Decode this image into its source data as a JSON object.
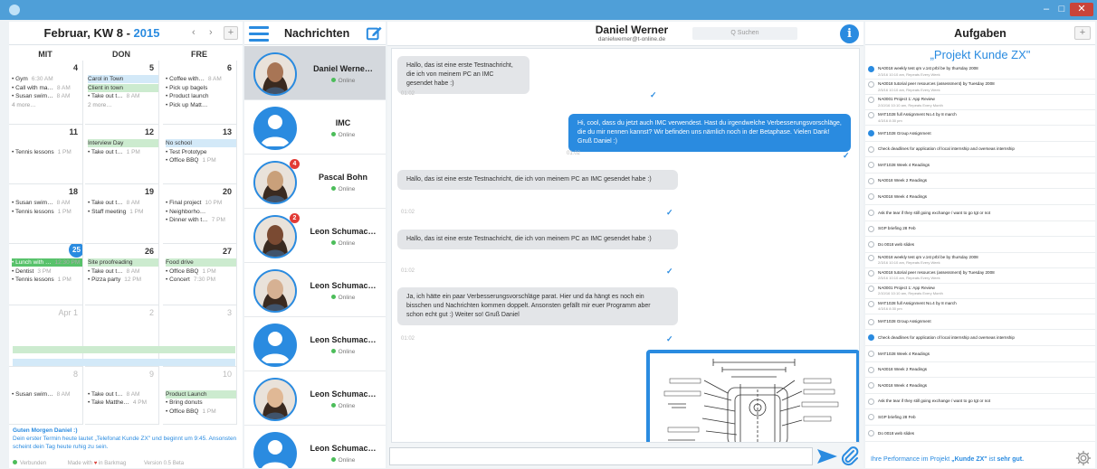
{
  "window": {
    "min": "‒",
    "max": "□",
    "close": "✕"
  },
  "calendar": {
    "month": "Februar, KW 8 - ",
    "year": "2015",
    "prev": "‹",
    "next": "›",
    "add": "+",
    "days": [
      "MIT",
      "DON",
      "FRE"
    ],
    "weeks": [
      {
        "days": [
          {
            "num": "4",
            "events": [
              {
                "txt": "• Gym",
                "time": "6:30 AM",
                "c": ""
              },
              {
                "txt": "• Call with ma…",
                "time": "8 AM",
                "c": ""
              },
              {
                "txt": "• Susan swim…",
                "time": "8 AM",
                "c": ""
              },
              {
                "txt": "4 more…",
                "time": "",
                "c": "m"
              }
            ]
          },
          {
            "num": "5",
            "events": [
              {
                "txt": "Carol in Town",
                "time": "",
                "c": "b"
              },
              {
                "txt": "Client in town",
                "time": "",
                "c": "g"
              },
              {
                "txt": "• Take out t…",
                "time": "8 AM",
                "c": ""
              },
              {
                "txt": "2 more…",
                "time": "",
                "c": "m"
              }
            ]
          },
          {
            "num": "6",
            "events": [
              {
                "txt": "• Coffee with…",
                "time": "8 AM",
                "c": ""
              },
              {
                "txt": "• Pick up bagels",
                "time": "",
                "c": ""
              },
              {
                "txt": "• Product launch",
                "time": "",
                "c": ""
              },
              {
                "txt": "• Pick up Matt…",
                "time": "",
                "c": ""
              }
            ]
          }
        ]
      },
      {
        "days": [
          {
            "num": "11",
            "events": [
              {
                "txt": "",
                "time": "",
                "c": ""
              },
              {
                "txt": "• Tennis lessons",
                "time": "1 PM",
                "c": ""
              }
            ]
          },
          {
            "num": "12",
            "events": [
              {
                "txt": "Interview Day",
                "time": "",
                "c": "g"
              },
              {
                "txt": "• Take out t…",
                "time": "1 PM",
                "c": ""
              }
            ]
          },
          {
            "num": "13",
            "events": [
              {
                "txt": "No school",
                "time": "",
                "c": "b"
              },
              {
                "txt": "• Test Prototype",
                "time": "",
                "c": ""
              },
              {
                "txt": "• Office BBQ",
                "time": "1 PM",
                "c": ""
              }
            ]
          }
        ]
      },
      {
        "days": [
          {
            "num": "18",
            "events": [
              {
                "txt": "• Susan swim…",
                "time": "8 AM",
                "c": ""
              },
              {
                "txt": "• Tennis lessons",
                "time": "1 PM",
                "c": ""
              }
            ]
          },
          {
            "num": "19",
            "events": [
              {
                "txt": "• Take out t…",
                "time": "8 AM",
                "c": ""
              },
              {
                "txt": "• Staff meeting",
                "time": "1 PM",
                "c": ""
              }
            ]
          },
          {
            "num": "20",
            "events": [
              {
                "txt": "• Final project",
                "time": "10 PM",
                "c": ""
              },
              {
                "txt": "• Neighborho…",
                "time": "",
                "c": ""
              },
              {
                "txt": "• Dinner with t…",
                "time": "7 PM",
                "c": ""
              }
            ]
          }
        ]
      },
      {
        "days": [
          {
            "num": "25",
            "events": [
              {
                "txt": "• Lunch with …",
                "time": "12:30 PM",
                "c": "gb"
              },
              {
                "txt": "• Dentist",
                "time": "3 PM",
                "c": ""
              },
              {
                "txt": "• Tennis lessons",
                "time": "1 PM",
                "c": ""
              }
            ]
          },
          {
            "num": "26",
            "events": [
              {
                "txt": "Site proofreading",
                "time": "",
                "c": "g"
              },
              {
                "txt": "• Take out t…",
                "time": "8 AM",
                "c": ""
              },
              {
                "txt": "• Pizza party",
                "time": "12 PM",
                "c": ""
              }
            ]
          },
          {
            "num": "27",
            "events": [
              {
                "txt": "Food drive",
                "time": "",
                "c": "g"
              },
              {
                "txt": "• Office BBQ",
                "time": "1 PM",
                "c": ""
              },
              {
                "txt": "• Concert",
                "time": "7:30 PM",
                "c": ""
              }
            ]
          }
        ]
      },
      {
        "days": [
          {
            "num": "Apr 1",
            "events": []
          },
          {
            "num": "2",
            "events": []
          },
          {
            "num": "3",
            "events": []
          }
        ]
      },
      {
        "days": [
          {
            "num": "8",
            "events": [
              {
                "txt": "",
                "time": "",
                "c": ""
              },
              {
                "txt": "• Susan swim…",
                "time": "8 AM",
                "c": ""
              }
            ]
          },
          {
            "num": "9",
            "events": [
              {
                "txt": "",
                "time": "",
                "c": ""
              },
              {
                "txt": "• Take out t…",
                "time": "8 AM",
                "c": ""
              },
              {
                "txt": "• Take Matthe…",
                "time": "4 PM",
                "c": ""
              }
            ]
          },
          {
            "num": "10",
            "events": [
              {
                "txt": "",
                "time": "",
                "c": ""
              },
              {
                "txt": "Product Launch",
                "time": "",
                "c": "g"
              },
              {
                "txt": "• Bring donuts",
                "time": "",
                "c": ""
              },
              {
                "txt": "• Office BBQ",
                "time": "1 PM",
                "c": ""
              }
            ]
          }
        ]
      }
    ],
    "greeting_name": "Guten Morgen Daniel :)",
    "greeting_text": "Dein erster Termin heute lautet „Telefonat Kunde ZX\" und beginnt um 9:45. Ansonsten scheint dein Tag heute ruhig zu sein.",
    "status_connected": "Verbunden",
    "status_made_pre": "Made with",
    "status_made_post": "in Barkmag",
    "status_version": "Version 0.5 Beta"
  },
  "contacts": {
    "title": "Nachrichten",
    "items": [
      {
        "name": "Daniel Werne…",
        "status": "Online",
        "badge": "",
        "type": "photo",
        "selected": true
      },
      {
        "name": "IMC",
        "status": "Online",
        "badge": "",
        "type": "blue",
        "selected": false
      },
      {
        "name": "Pascal Bohn",
        "status": "Online",
        "badge": "4",
        "type": "photo",
        "selected": false
      },
      {
        "name": "Leon Schumac…",
        "status": "Online",
        "badge": "2",
        "type": "photo",
        "selected": false
      },
      {
        "name": "Leon Schumac…",
        "status": "Online",
        "badge": "",
        "type": "photo",
        "selected": false
      },
      {
        "name": "Leon Schumac…",
        "status": "Online",
        "badge": "",
        "type": "blue",
        "selected": false
      },
      {
        "name": "Leon Schumac…",
        "status": "Online",
        "badge": "",
        "type": "photo",
        "selected": false
      },
      {
        "name": "Leon Schumac…",
        "status": "Online",
        "badge": "",
        "type": "blue",
        "selected": false
      }
    ]
  },
  "chat": {
    "name": "Daniel Werner",
    "email": "danielwerner@t-online.de",
    "search_placeholder": "Q Suchen",
    "info": "i",
    "messages": [
      {
        "dir": "in",
        "text": "Hallo, das ist eine erste Testnachricht, die ich von meinem PC an IMC gesendet habe :)",
        "time": "01:02"
      },
      {
        "dir": "out",
        "text": "Hi, cool, dass du jetzt auch IMC verwendest. Hast du irgendwelche Verbesserungsvorschläge, die du mir nennen kannst? Wir befinden uns nämlich noch in der Betaphase. Vielen Dank! Gruß Daniel :)",
        "time": "01:02"
      },
      {
        "dir": "in",
        "text": "Hallo, das ist eine erste Testnachricht, die ich von meinem PC an IMC gesendet habe :)",
        "time": "01:02"
      },
      {
        "dir": "in",
        "text": "Hallo, das ist eine erste Testnachricht, die ich von meinem PC an IMC gesendet habe :)",
        "time": "01:02"
      },
      {
        "dir": "in",
        "text": "Ja, ich hätte ein paar Verbesserungsvorschläge parat. Hier und da hängt es noch ein bisschen und Nachrichten kommen doppelt. Ansonsten gefällt mir euer Programm aber schon echt gut :) Weiter so! Gruß Daniel",
        "time": "01:02"
      }
    ],
    "attachment_label": "drawing-attachment",
    "message_placeholder": ""
  },
  "tasks": {
    "title": "Aufgaben",
    "add": "+",
    "project": "„Projekt Kunde ZX\"",
    "items": [
      {
        "title": "NA0018 weekly test qm v.1st prbl be by thursday 2008",
        "sub": "2/3/16 10:10 am, Repeats Every Week",
        "on": true
      },
      {
        "title": "NA0018 tutorial peer resources (assessment) by Tuesday 2008",
        "sub": "2/5/16 10:10 am, Repeats Every Week",
        "on": false
      },
      {
        "title": "NA0001 Project 1: App Review",
        "sub": "2/10/16 10:10 am, Repeats Every Month",
        "on": false
      },
      {
        "title": "MAT1028 full Assignment No.4 by 8 march",
        "sub": "4/3/16 8:30 pm",
        "on": false
      },
      {
        "title": "MAT1028 Group Assignment",
        "sub": "",
        "on": true
      },
      {
        "title": "Check deadlines for application of local internship and overseas internship",
        "sub": "",
        "on": false
      },
      {
        "title": "MAT1028 Week 4 Readings",
        "sub": "",
        "on": false
      },
      {
        "title": "NA0018 Week 2 Readings",
        "sub": "",
        "on": false
      },
      {
        "title": "NA0018 Week 4 Readings",
        "sub": "",
        "on": false
      },
      {
        "title": "Ask the tear if they still going exchange / want to go tgt or not",
        "sub": "",
        "on": false
      },
      {
        "title": "SGP briefing 28 Feb",
        "sub": "",
        "on": false
      },
      {
        "title": "Do 0018 web slides",
        "sub": "",
        "on": false
      },
      {
        "title": "NA0018 weekly test qm v.1st prbl be by thursday 2008",
        "sub": "2/3/16 10:10 am, Repeats Every Week",
        "on": false
      },
      {
        "title": "NA0018 tutorial peer resources (assessment) by Tuesday 2008",
        "sub": "2/5/16 10:10 am, Repeats Every Week",
        "on": false
      },
      {
        "title": "NA0001 Project 1: App Review",
        "sub": "2/10/16 10:10 am, Repeats Every Month",
        "on": false
      },
      {
        "title": "MAT1028 full Assignment No.4 by 8 march",
        "sub": "4/3/16 8:30 pm",
        "on": false
      },
      {
        "title": "MAT1028 Group Assignment",
        "sub": "",
        "on": false
      },
      {
        "title": "Check deadlines for application of local internship and overseas internship",
        "sub": "",
        "on": true
      },
      {
        "title": "MAT1028 Week 4 Readings",
        "sub": "",
        "on": false
      },
      {
        "title": "NA0018 Week 2 Readings",
        "sub": "",
        "on": false
      },
      {
        "title": "NA0018 Week 4 Readings",
        "sub": "",
        "on": false
      },
      {
        "title": "Ask the tear if they still going exchange / want to go tgt or not",
        "sub": "",
        "on": false
      },
      {
        "title": "SGP briefing 28 Feb",
        "sub": "",
        "on": false
      },
      {
        "title": "Do 0018 web slides",
        "sub": "",
        "on": false
      }
    ],
    "footer_pre": "Ihre Performance im Projekt ",
    "footer_proj": "„Kunde ZX\"",
    "footer_mid": " ist ",
    "footer_val": "sehr gut."
  },
  "colors": {
    "accent": "#2a8be0",
    "online": "#4cbd5a",
    "badge": "#e23b35",
    "titlebar": "#4f9fd8"
  },
  "icons": {
    "menu": "hamburger-icon",
    "compose": "compose-icon",
    "info": "info-icon",
    "send": "send-icon",
    "attach": "paperclip-icon",
    "settings": "gear-icon"
  }
}
